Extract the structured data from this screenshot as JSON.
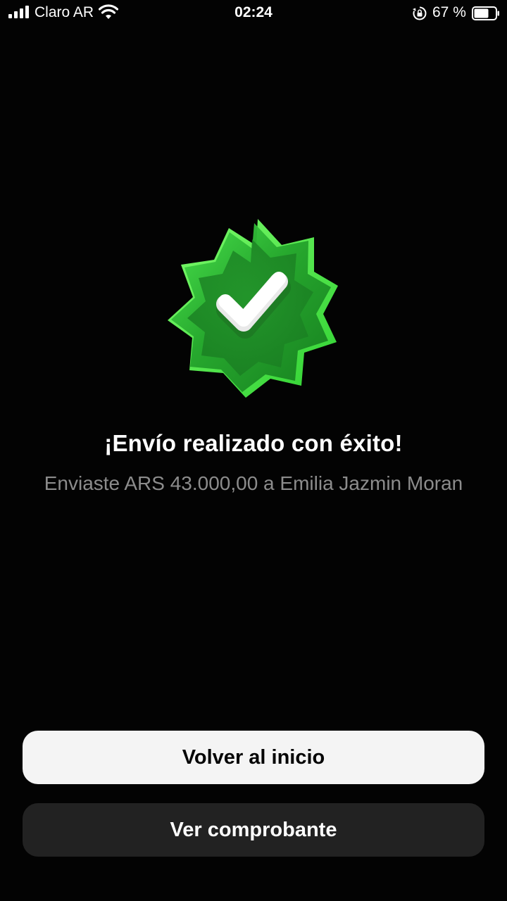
{
  "status_bar": {
    "carrier": "Claro AR",
    "time": "02:24",
    "battery_percent": "67 %",
    "battery_level": 0.67,
    "signal_icon": "cellular-signal-icon",
    "wifi_icon": "wifi-icon",
    "rotation_lock_icon": "rotation-lock-icon",
    "battery_icon": "battery-icon"
  },
  "main": {
    "icon": "verified-check-badge-icon",
    "badge_color": "#2fbf3a",
    "title": "¡Envío realizado con éxito!",
    "subtitle": "Enviaste ARS 43.000,00 a Emilia Jazmin Moran"
  },
  "actions": {
    "home_label": "Volver al inicio",
    "receipt_label": "Ver comprobante"
  }
}
